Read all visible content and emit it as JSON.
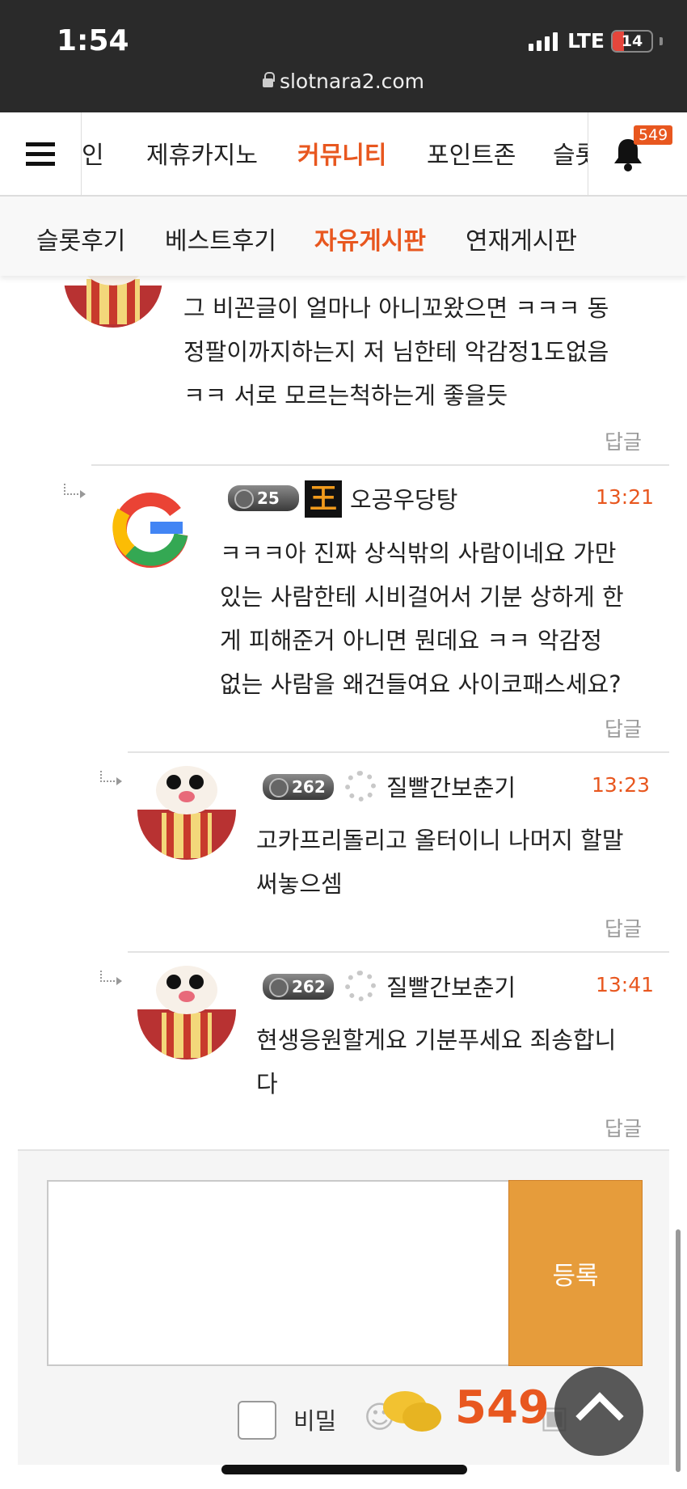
{
  "status_bar": {
    "time": "1:54",
    "network": "LTE",
    "battery": "14",
    "url": "slotnara2.com"
  },
  "nav": {
    "items": [
      "인",
      "제휴카지노",
      "커뮤니티",
      "포인트존",
      "슬롯"
    ],
    "active": "커뮤니티",
    "notification_count": "549"
  },
  "subnav": {
    "items": [
      "슬롯후기",
      "베스트후기",
      "자유게시판",
      "연재게시판"
    ],
    "active": "자유게시판"
  },
  "comments": [
    {
      "lines": [
        "그 비꼰글이 얼마나 아니꼬왔으면 ㅋㅋㅋ 동",
        "정팔이까지하는지 저 님한테 악감정1도없음",
        "ㅋㅋ 서로 모르는척하는게 좋을듯"
      ],
      "reply_label": "답글"
    },
    {
      "level": "25",
      "king": "王",
      "username": "오공우당탕",
      "time": "13:21",
      "lines": [
        "ㅋㅋㅋ아 진짜 상식밖의 사람이네요 가만",
        "있는 사람한테 시비걸어서 기분 상하게 한",
        "게 피해준거 아니면 뭔데요 ㅋㅋ 악감정",
        "없는 사람을 왜건들여요 사이코패스세요?"
      ],
      "reply_label": "답글"
    },
    {
      "level": "262",
      "username": "질빨간보춘기",
      "time": "13:23",
      "lines": [
        "고카프리돌리고 올터이니 나머지 할말",
        "써놓으셈"
      ],
      "reply_label": "답글"
    },
    {
      "level": "262",
      "username": "질빨간보춘기",
      "time": "13:41",
      "lines": [
        "현생응원할게요 기분푸세요 죄송합니",
        "다"
      ],
      "reply_label": "답글"
    }
  ],
  "form": {
    "submit_label": "등록",
    "secret_label": "비밀",
    "floating_count": "549"
  },
  "colors": {
    "accent": "#e8571f",
    "submit": "#e69c3b"
  }
}
